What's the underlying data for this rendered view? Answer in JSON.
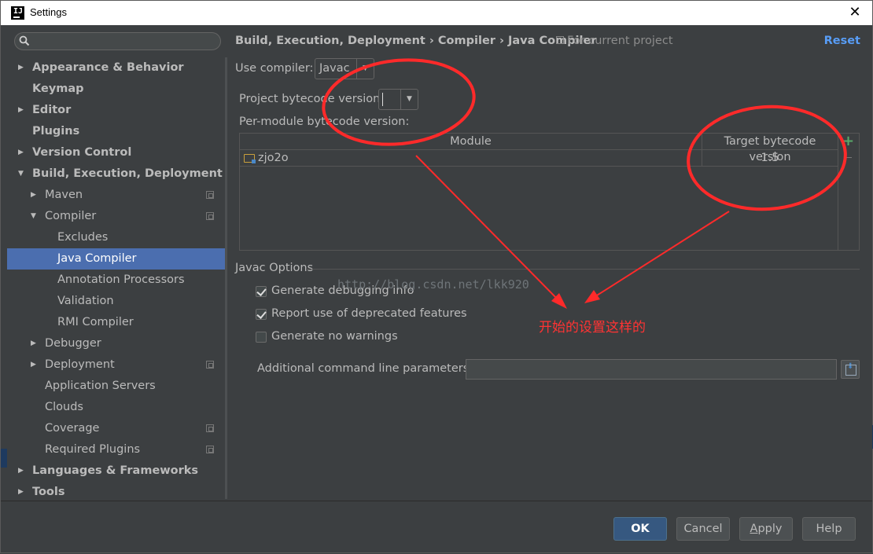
{
  "window": {
    "title": "Settings",
    "close_glyph": "✕"
  },
  "sidebar": {
    "search_placeholder": "",
    "items": [
      {
        "label": "Appearance & Behavior",
        "bold": true,
        "level": 0,
        "arrow": "right"
      },
      {
        "label": "Keymap",
        "bold": true,
        "level": 0,
        "arrow": "none"
      },
      {
        "label": "Editor",
        "bold": true,
        "level": 0,
        "arrow": "right"
      },
      {
        "label": "Plugins",
        "bold": true,
        "level": 0,
        "arrow": "none"
      },
      {
        "label": "Version Control",
        "bold": true,
        "level": 0,
        "arrow": "right"
      },
      {
        "label": "Build, Execution, Deployment",
        "bold": true,
        "level": 0,
        "arrow": "down"
      },
      {
        "label": "Maven",
        "level": 1,
        "arrow": "right",
        "project_icon": true
      },
      {
        "label": "Compiler",
        "level": 1,
        "arrow": "down",
        "project_icon": true
      },
      {
        "label": "Excludes",
        "level": 2,
        "arrow": "none"
      },
      {
        "label": "Java Compiler",
        "level": 2,
        "arrow": "none",
        "selected": true
      },
      {
        "label": "Annotation Processors",
        "level": 2,
        "arrow": "none"
      },
      {
        "label": "Validation",
        "level": 2,
        "arrow": "none"
      },
      {
        "label": "RMI Compiler",
        "level": 2,
        "arrow": "none"
      },
      {
        "label": "Debugger",
        "level": 1,
        "arrow": "right"
      },
      {
        "label": "Deployment",
        "level": 1,
        "arrow": "right",
        "project_icon": true
      },
      {
        "label": "Application Servers",
        "level": 1,
        "arrow": "none"
      },
      {
        "label": "Clouds",
        "level": 1,
        "arrow": "none"
      },
      {
        "label": "Coverage",
        "level": 1,
        "arrow": "none",
        "project_icon": true
      },
      {
        "label": "Required Plugins",
        "level": 1,
        "arrow": "none",
        "project_icon": true
      },
      {
        "label": "Languages & Frameworks",
        "bold": true,
        "level": 0,
        "arrow": "right"
      },
      {
        "label": "Tools",
        "bold": true,
        "level": 0,
        "arrow": "right"
      }
    ]
  },
  "header": {
    "breadcrumb": "Build, Execution, Deployment › Compiler › Java Compiler",
    "scope": "For current project",
    "reset_label": "Reset"
  },
  "compiler": {
    "use_compiler_label": "Use compiler:",
    "use_compiler_value": "Javac",
    "project_bytecode_label": "Project bytecode version:",
    "project_bytecode_value": "",
    "per_module_label": "Per-module bytecode version:"
  },
  "module_table": {
    "columns": [
      "Module",
      "Target bytecode version"
    ],
    "rows": [
      {
        "module": "zjo2o",
        "target": "1.5"
      }
    ]
  },
  "javac_options": {
    "title": "Javac Options",
    "checkboxes": [
      {
        "label": "Generate debugging info",
        "checked": true
      },
      {
        "label": "Report use of deprecated features",
        "checked": true
      },
      {
        "label": "Generate no warnings",
        "checked": false
      }
    ],
    "params_label": "Additional command line parameters:",
    "params_value": ""
  },
  "footer": {
    "ok": "OK",
    "cancel": "Cancel",
    "apply": "Apply",
    "help": "Help"
  },
  "annotation": {
    "watermark": "http://blog.csdn.net/lkk920",
    "note": "开始的设置这样的",
    "color": "#ff3333"
  },
  "colors": {
    "background": "#3c3f41",
    "selection": "#4b6eaf",
    "link": "#589df6",
    "primary_button": "#365880"
  }
}
